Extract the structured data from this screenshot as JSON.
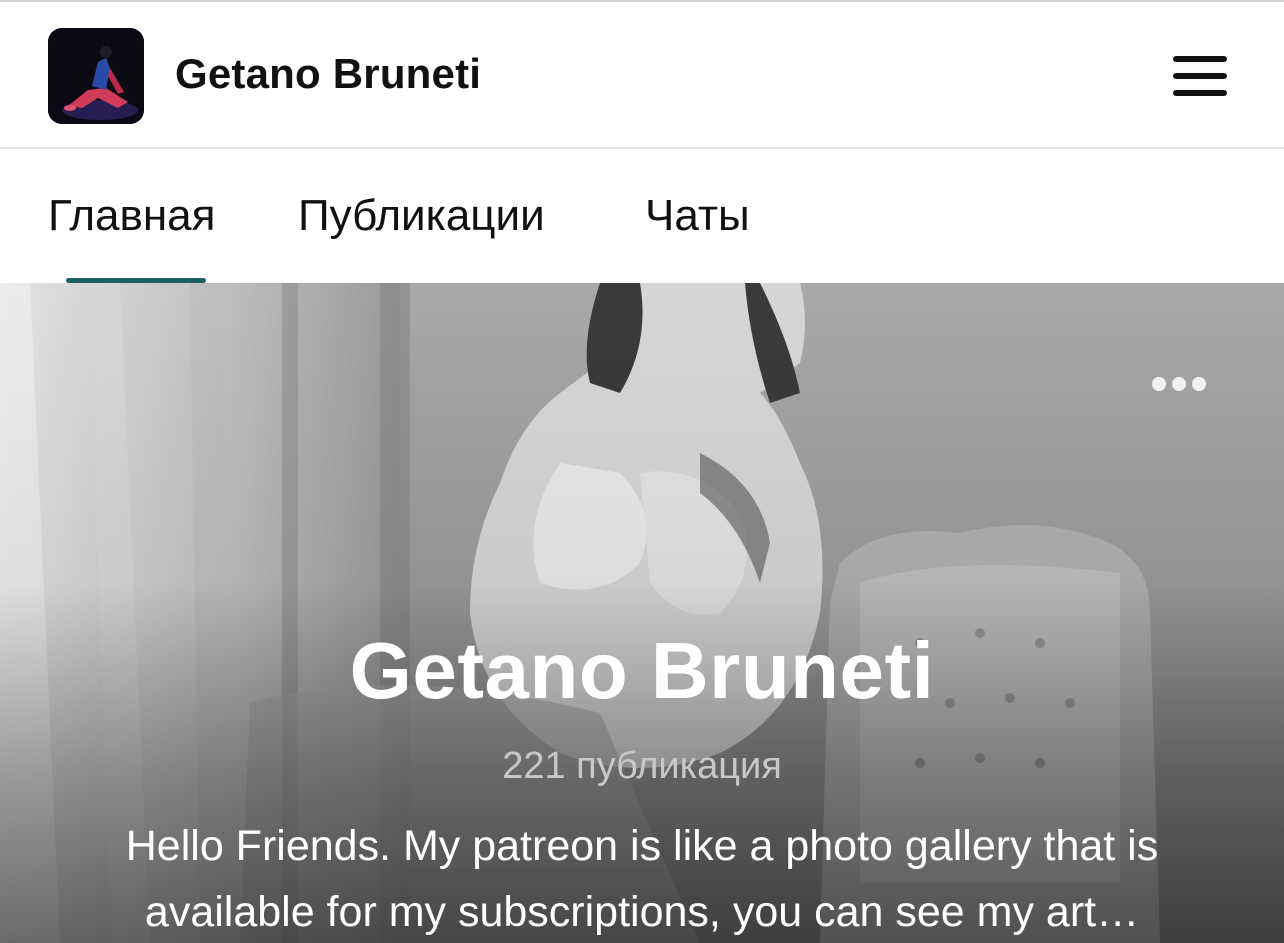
{
  "header": {
    "creator_name": "Getano Bruneti",
    "menu_icon": "hamburger-menu-icon"
  },
  "tabs": [
    {
      "label": "Главная",
      "active": true
    },
    {
      "label": "Публикации",
      "active": false
    },
    {
      "label": "Чаты",
      "active": false
    }
  ],
  "colors": {
    "accent": "#1d5f66"
  },
  "hero": {
    "more_icon": "more-dots-icon",
    "title": "Getano Bruneti",
    "post_count": "221 публикация",
    "description_line1": "Hello Friends. My patreon is like a photo gallery that is",
    "description_line2": "available for my subscriptions, you can see my art…"
  }
}
